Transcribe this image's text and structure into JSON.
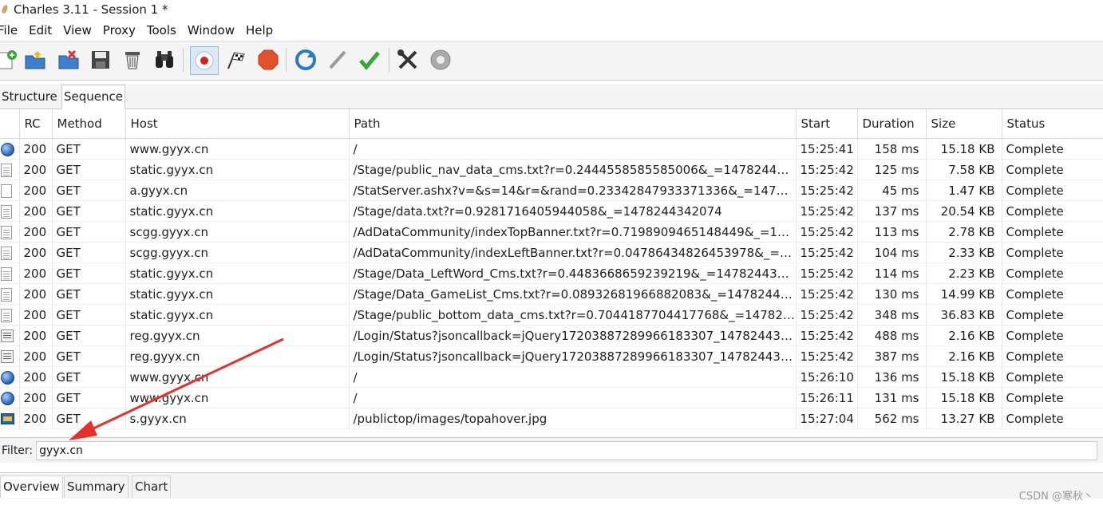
{
  "window": {
    "title": "Charles 3.11 - Session 1 *"
  },
  "menu": [
    "File",
    "Edit",
    "View",
    "Proxy",
    "Tools",
    "Window",
    "Help"
  ],
  "toolbar": {
    "icons": [
      "new-session-icon",
      "open-session-icon",
      "close-session-icon",
      "save-icon",
      "trash-icon",
      "find-icon",
      "record-icon",
      "throttle-icon",
      "stop-icon",
      "repeat-icon",
      "edit-icon",
      "validate-icon",
      "tools-icon",
      "settings-icon"
    ]
  },
  "view_tabs": [
    "Structure",
    "Sequence"
  ],
  "table": {
    "columns": [
      "RC",
      "Method",
      "Host",
      "Path",
      "Start",
      "Duration",
      "Size",
      "Status"
    ],
    "rows": [
      {
        "icon": "web-icon",
        "rc": "200",
        "method": "GET",
        "host": "www.gyyx.cn",
        "path": "/",
        "start": "15:25:41",
        "duration": "158 ms",
        "size": "15.18 KB",
        "status": "Complete"
      },
      {
        "icon": "document-icon",
        "rc": "200",
        "method": "GET",
        "host": "static.gyyx.cn",
        "path": "/Stage/public_nav_data_cms.txt?r=0.2444558585585006&_=1478244342...",
        "start": "15:25:42",
        "duration": "125 ms",
        "size": "7.58 KB",
        "status": "Complete"
      },
      {
        "icon": "blank-icon",
        "rc": "200",
        "method": "GET",
        "host": "a.gyyx.cn",
        "path": "/StatServer.ashx?v=&s=14&r=&rand=0.23342847933371336&_=14782...",
        "start": "15:25:42",
        "duration": "45 ms",
        "size": "1.47 KB",
        "status": "Complete"
      },
      {
        "icon": "document-icon",
        "rc": "200",
        "method": "GET",
        "host": "static.gyyx.cn",
        "path": "/Stage/data.txt?r=0.9281716405944058&_=1478244342074",
        "start": "15:25:42",
        "duration": "137 ms",
        "size": "20.54 KB",
        "status": "Complete"
      },
      {
        "icon": "document-icon",
        "rc": "200",
        "method": "GET",
        "host": "scgg.gyyx.cn",
        "path": "/AdDataCommunity/indexTopBanner.txt?r=0.7198909465148449&_=14...",
        "start": "15:25:42",
        "duration": "113 ms",
        "size": "2.78 KB",
        "status": "Complete"
      },
      {
        "icon": "document-icon",
        "rc": "200",
        "method": "GET",
        "host": "scgg.gyyx.cn",
        "path": "/AdDataCommunity/indexLeftBanner.txt?r=0.04786434826453978&_=14...",
        "start": "15:25:42",
        "duration": "104 ms",
        "size": "2.33 KB",
        "status": "Complete"
      },
      {
        "icon": "document-icon",
        "rc": "200",
        "method": "GET",
        "host": "static.gyyx.cn",
        "path": "/Stage/Data_LeftWord_Cms.txt?r=0.4483668659239219&_=14782443434...",
        "start": "15:25:42",
        "duration": "114 ms",
        "size": "2.23 KB",
        "status": "Complete"
      },
      {
        "icon": "document-icon",
        "rc": "200",
        "method": "GET",
        "host": "static.gyyx.cn",
        "path": "/Stage/Data_GameList_Cms.txt?r=0.08932681966882083&_=147824434...",
        "start": "15:25:42",
        "duration": "130 ms",
        "size": "14.99 KB",
        "status": "Complete"
      },
      {
        "icon": "document-icon",
        "rc": "200",
        "method": "GET",
        "host": "static.gyyx.cn",
        "path": "/Stage/public_bottom_data_cms.txt?r=0.7044187704417768&_=147824...",
        "start": "15:25:42",
        "duration": "348 ms",
        "size": "36.83 KB",
        "status": "Complete"
      },
      {
        "icon": "script-icon",
        "rc": "200",
        "method": "GET",
        "host": "reg.gyyx.cn",
        "path": "/Login/Status?jsoncallback=jQuery17203887289966183307_1478244342...",
        "start": "15:25:42",
        "duration": "488 ms",
        "size": "2.16 KB",
        "status": "Complete"
      },
      {
        "icon": "script-icon",
        "rc": "200",
        "method": "GET",
        "host": "reg.gyyx.cn",
        "path": "/Login/Status?jsoncallback=jQuery17203887289966183307_1478244342...",
        "start": "15:25:42",
        "duration": "387 ms",
        "size": "2.16 KB",
        "status": "Complete"
      },
      {
        "icon": "web-icon",
        "rc": "200",
        "method": "GET",
        "host": "www.gyyx.cn",
        "path": "/",
        "start": "15:26:10",
        "duration": "136 ms",
        "size": "15.18 KB",
        "status": "Complete"
      },
      {
        "icon": "web-icon",
        "rc": "200",
        "method": "GET",
        "host": "www.gyyx.cn",
        "path": "/",
        "start": "15:26:11",
        "duration": "131 ms",
        "size": "15.18 KB",
        "status": "Complete"
      },
      {
        "icon": "image-icon",
        "rc": "200",
        "method": "GET",
        "host": "s.gyyx.cn",
        "path": "/publictop/images/topahover.jpg",
        "start": "15:27:04",
        "duration": "562 ms",
        "size": "13.27 KB",
        "status": "Complete"
      }
    ]
  },
  "filter": {
    "label": "Filter:",
    "value": "gyyx.cn"
  },
  "bottom_tabs": [
    "Overview",
    "Summary",
    "Chart"
  ],
  "watermark": "CSDN @寒秋丶",
  "colors": {
    "annotation_arrow": "#e5312c",
    "selected_tool": "#dbe8f6"
  }
}
